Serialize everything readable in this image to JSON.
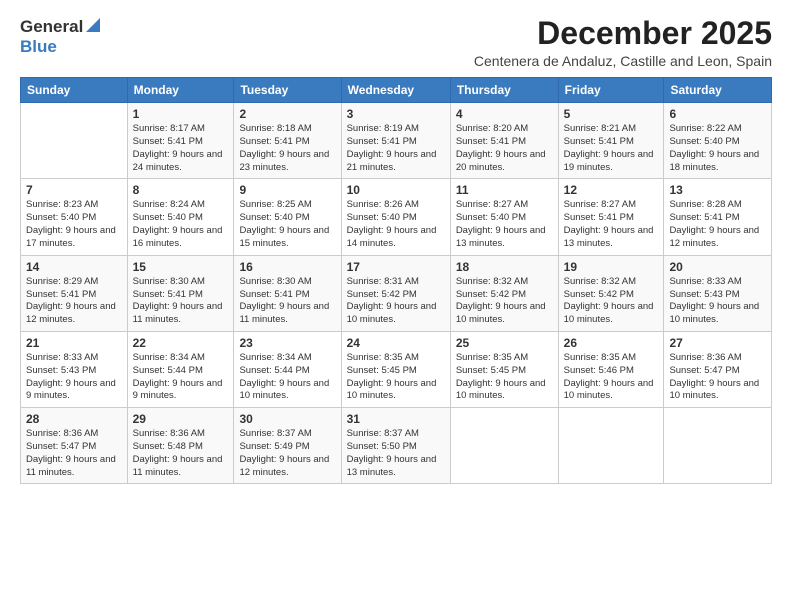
{
  "logo": {
    "general": "General",
    "blue": "Blue",
    "tagline": ""
  },
  "title": "December 2025",
  "location": "Centenera de Andaluz, Castille and Leon, Spain",
  "days_of_week": [
    "Sunday",
    "Monday",
    "Tuesday",
    "Wednesday",
    "Thursday",
    "Friday",
    "Saturday"
  ],
  "weeks": [
    [
      {
        "day": "",
        "sunrise": "",
        "sunset": "",
        "daylight": ""
      },
      {
        "day": "1",
        "sunrise": "Sunrise: 8:17 AM",
        "sunset": "Sunset: 5:41 PM",
        "daylight": "Daylight: 9 hours and 24 minutes."
      },
      {
        "day": "2",
        "sunrise": "Sunrise: 8:18 AM",
        "sunset": "Sunset: 5:41 PM",
        "daylight": "Daylight: 9 hours and 23 minutes."
      },
      {
        "day": "3",
        "sunrise": "Sunrise: 8:19 AM",
        "sunset": "Sunset: 5:41 PM",
        "daylight": "Daylight: 9 hours and 21 minutes."
      },
      {
        "day": "4",
        "sunrise": "Sunrise: 8:20 AM",
        "sunset": "Sunset: 5:41 PM",
        "daylight": "Daylight: 9 hours and 20 minutes."
      },
      {
        "day": "5",
        "sunrise": "Sunrise: 8:21 AM",
        "sunset": "Sunset: 5:41 PM",
        "daylight": "Daylight: 9 hours and 19 minutes."
      },
      {
        "day": "6",
        "sunrise": "Sunrise: 8:22 AM",
        "sunset": "Sunset: 5:40 PM",
        "daylight": "Daylight: 9 hours and 18 minutes."
      }
    ],
    [
      {
        "day": "7",
        "sunrise": "Sunrise: 8:23 AM",
        "sunset": "Sunset: 5:40 PM",
        "daylight": "Daylight: 9 hours and 17 minutes."
      },
      {
        "day": "8",
        "sunrise": "Sunrise: 8:24 AM",
        "sunset": "Sunset: 5:40 PM",
        "daylight": "Daylight: 9 hours and 16 minutes."
      },
      {
        "day": "9",
        "sunrise": "Sunrise: 8:25 AM",
        "sunset": "Sunset: 5:40 PM",
        "daylight": "Daylight: 9 hours and 15 minutes."
      },
      {
        "day": "10",
        "sunrise": "Sunrise: 8:26 AM",
        "sunset": "Sunset: 5:40 PM",
        "daylight": "Daylight: 9 hours and 14 minutes."
      },
      {
        "day": "11",
        "sunrise": "Sunrise: 8:27 AM",
        "sunset": "Sunset: 5:40 PM",
        "daylight": "Daylight: 9 hours and 13 minutes."
      },
      {
        "day": "12",
        "sunrise": "Sunrise: 8:27 AM",
        "sunset": "Sunset: 5:41 PM",
        "daylight": "Daylight: 9 hours and 13 minutes."
      },
      {
        "day": "13",
        "sunrise": "Sunrise: 8:28 AM",
        "sunset": "Sunset: 5:41 PM",
        "daylight": "Daylight: 9 hours and 12 minutes."
      }
    ],
    [
      {
        "day": "14",
        "sunrise": "Sunrise: 8:29 AM",
        "sunset": "Sunset: 5:41 PM",
        "daylight": "Daylight: 9 hours and 12 minutes."
      },
      {
        "day": "15",
        "sunrise": "Sunrise: 8:30 AM",
        "sunset": "Sunset: 5:41 PM",
        "daylight": "Daylight: 9 hours and 11 minutes."
      },
      {
        "day": "16",
        "sunrise": "Sunrise: 8:30 AM",
        "sunset": "Sunset: 5:41 PM",
        "daylight": "Daylight: 9 hours and 11 minutes."
      },
      {
        "day": "17",
        "sunrise": "Sunrise: 8:31 AM",
        "sunset": "Sunset: 5:42 PM",
        "daylight": "Daylight: 9 hours and 10 minutes."
      },
      {
        "day": "18",
        "sunrise": "Sunrise: 8:32 AM",
        "sunset": "Sunset: 5:42 PM",
        "daylight": "Daylight: 9 hours and 10 minutes."
      },
      {
        "day": "19",
        "sunrise": "Sunrise: 8:32 AM",
        "sunset": "Sunset: 5:42 PM",
        "daylight": "Daylight: 9 hours and 10 minutes."
      },
      {
        "day": "20",
        "sunrise": "Sunrise: 8:33 AM",
        "sunset": "Sunset: 5:43 PM",
        "daylight": "Daylight: 9 hours and 10 minutes."
      }
    ],
    [
      {
        "day": "21",
        "sunrise": "Sunrise: 8:33 AM",
        "sunset": "Sunset: 5:43 PM",
        "daylight": "Daylight: 9 hours and 9 minutes."
      },
      {
        "day": "22",
        "sunrise": "Sunrise: 8:34 AM",
        "sunset": "Sunset: 5:44 PM",
        "daylight": "Daylight: 9 hours and 9 minutes."
      },
      {
        "day": "23",
        "sunrise": "Sunrise: 8:34 AM",
        "sunset": "Sunset: 5:44 PM",
        "daylight": "Daylight: 9 hours and 10 minutes."
      },
      {
        "day": "24",
        "sunrise": "Sunrise: 8:35 AM",
        "sunset": "Sunset: 5:45 PM",
        "daylight": "Daylight: 9 hours and 10 minutes."
      },
      {
        "day": "25",
        "sunrise": "Sunrise: 8:35 AM",
        "sunset": "Sunset: 5:45 PM",
        "daylight": "Daylight: 9 hours and 10 minutes."
      },
      {
        "day": "26",
        "sunrise": "Sunrise: 8:35 AM",
        "sunset": "Sunset: 5:46 PM",
        "daylight": "Daylight: 9 hours and 10 minutes."
      },
      {
        "day": "27",
        "sunrise": "Sunrise: 8:36 AM",
        "sunset": "Sunset: 5:47 PM",
        "daylight": "Daylight: 9 hours and 10 minutes."
      }
    ],
    [
      {
        "day": "28",
        "sunrise": "Sunrise: 8:36 AM",
        "sunset": "Sunset: 5:47 PM",
        "daylight": "Daylight: 9 hours and 11 minutes."
      },
      {
        "day": "29",
        "sunrise": "Sunrise: 8:36 AM",
        "sunset": "Sunset: 5:48 PM",
        "daylight": "Daylight: 9 hours and 11 minutes."
      },
      {
        "day": "30",
        "sunrise": "Sunrise: 8:37 AM",
        "sunset": "Sunset: 5:49 PM",
        "daylight": "Daylight: 9 hours and 12 minutes."
      },
      {
        "day": "31",
        "sunrise": "Sunrise: 8:37 AM",
        "sunset": "Sunset: 5:50 PM",
        "daylight": "Daylight: 9 hours and 13 minutes."
      },
      {
        "day": "",
        "sunrise": "",
        "sunset": "",
        "daylight": ""
      },
      {
        "day": "",
        "sunrise": "",
        "sunset": "",
        "daylight": ""
      },
      {
        "day": "",
        "sunrise": "",
        "sunset": "",
        "daylight": ""
      }
    ]
  ]
}
